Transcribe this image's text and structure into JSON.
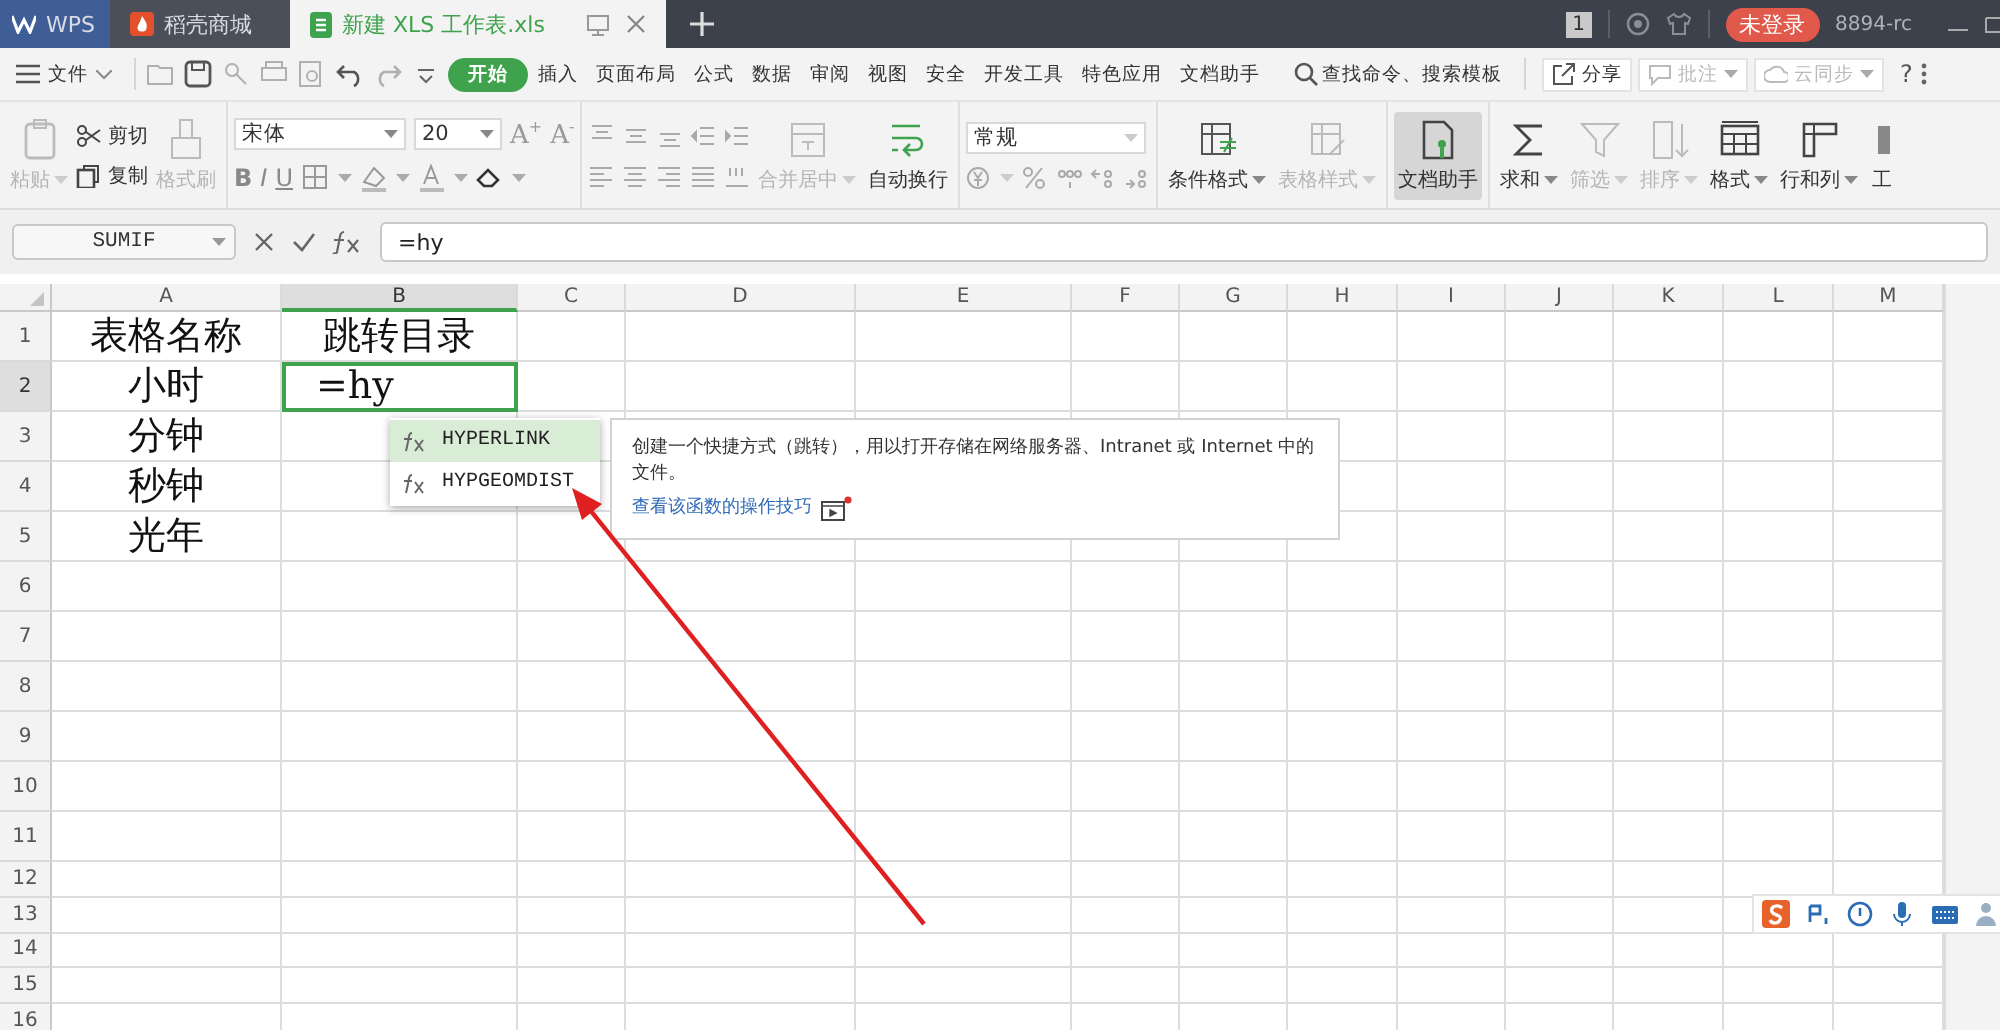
{
  "titlebar": {
    "tabs": [
      {
        "label": "WPS",
        "kind": "home",
        "selected": false
      },
      {
        "label": "稻壳商城",
        "kind": "store",
        "selected": false
      },
      {
        "label": "新建 XLS 工作表.xls",
        "kind": "document",
        "selected": true
      }
    ],
    "badge": "1",
    "login": "未登录",
    "user": "8894-rc"
  },
  "menubar": {
    "file": "文件",
    "tabs": [
      {
        "label": "开始",
        "selected": true
      },
      {
        "label": "插入",
        "selected": false
      },
      {
        "label": "页面布局",
        "selected": false
      },
      {
        "label": "公式",
        "selected": false
      },
      {
        "label": "数据",
        "selected": false
      },
      {
        "label": "审阅",
        "selected": false
      },
      {
        "label": "视图",
        "selected": false
      },
      {
        "label": "安全",
        "selected": false
      },
      {
        "label": "开发工具",
        "selected": false
      },
      {
        "label": "特色应用",
        "selected": false
      },
      {
        "label": "文档助手",
        "selected": false
      }
    ],
    "search": "查找命令、搜索模板",
    "share": "分享",
    "comment": {
      "label": "批注",
      "disabled": true
    },
    "sync": {
      "label": "云同步",
      "disabled": true
    },
    "help": "?"
  },
  "ribbon": {
    "clipboard": [
      {
        "label": "粘贴",
        "disabled": true
      },
      {
        "label": "剪切",
        "disabled": false
      },
      {
        "label": "复制",
        "disabled": false
      },
      {
        "label": "格式刷",
        "disabled": true
      }
    ],
    "font": {
      "name": "宋体",
      "size": "20",
      "grow": "A$^{+}$",
      "shrink": "A$^{-}$",
      "styles": [
        "B",
        "I",
        "U"
      ]
    },
    "merge": {
      "label": "合并居中",
      "disabled": true
    },
    "wrap": {
      "label": "自动换行",
      "disabled": false
    },
    "number_format": "常规",
    "tools": [
      {
        "label": "条件格式",
        "disabled": false,
        "selected": false,
        "dropdown": true
      },
      {
        "label": "表格样式",
        "disabled": true,
        "selected": false,
        "dropdown": true
      },
      {
        "label": "文档助手",
        "disabled": false,
        "selected": true,
        "dropdown": false
      },
      {
        "label": "求和",
        "disabled": false,
        "selected": false,
        "dropdown": true
      },
      {
        "label": "筛选",
        "disabled": true,
        "selected": false,
        "dropdown": true
      },
      {
        "label": "排序",
        "disabled": true,
        "selected": false,
        "dropdown": true
      },
      {
        "label": "格式",
        "disabled": false,
        "selected": false,
        "dropdown": true
      },
      {
        "label": "行和列",
        "disabled": false,
        "selected": false,
        "dropdown": true
      },
      {
        "label": "工",
        "disabled": false,
        "selected": false,
        "dropdown": false
      }
    ]
  },
  "formula_bar": {
    "name_box": "SUMIF",
    "value": "=hy"
  },
  "sheet": {
    "columns": [
      {
        "label": "A",
        "selected": false
      },
      {
        "label": "B",
        "selected": true
      },
      {
        "label": "C",
        "selected": false
      },
      {
        "label": "D",
        "selected": false
      },
      {
        "label": "E",
        "selected": false
      },
      {
        "label": "F",
        "selected": false
      },
      {
        "label": "G",
        "selected": false
      },
      {
        "label": "H",
        "selected": false
      },
      {
        "label": "I",
        "selected": false
      },
      {
        "label": "J",
        "selected": false
      },
      {
        "label": "K",
        "selected": false
      },
      {
        "label": "L",
        "selected": false
      },
      {
        "label": "M",
        "selected": false
      }
    ],
    "rows": [
      {
        "label": "1",
        "selected": false,
        "cells": [
          {
            "text": "表格名称",
            "active": false
          },
          {
            "text": "跳转目录",
            "active": false
          }
        ]
      },
      {
        "label": "2",
        "selected": true,
        "cells": [
          {
            "text": "小时",
            "active": false
          },
          {
            "text": "=hy",
            "active": true
          }
        ]
      },
      {
        "label": "3",
        "selected": false,
        "cells": [
          {
            "text": "分钟",
            "active": false
          }
        ]
      },
      {
        "label": "4",
        "selected": false,
        "cells": [
          {
            "text": "秒钟",
            "active": false
          }
        ]
      },
      {
        "label": "5",
        "selected": false,
        "cells": [
          {
            "text": "光年",
            "active": false
          }
        ]
      },
      {
        "label": "6",
        "selected": false
      },
      {
        "label": "7",
        "selected": false
      },
      {
        "label": "8",
        "selected": false
      },
      {
        "label": "9",
        "selected": false
      },
      {
        "label": "10",
        "selected": false
      },
      {
        "label": "11",
        "selected": false
      },
      {
        "label": "12",
        "selected": false
      },
      {
        "label": "13",
        "selected": false
      },
      {
        "label": "14",
        "selected": false
      },
      {
        "label": "15",
        "selected": false
      },
      {
        "label": "16",
        "selected": false
      }
    ]
  },
  "autocomplete": {
    "items": [
      {
        "label": "HYPERLINK",
        "selected": true
      },
      {
        "label": "HYPGEOMDIST",
        "selected": false
      }
    ],
    "description": "创建一个快捷方式（跳转），用以打开存储在网络服务器、Intranet 或 Internet 中的文件。",
    "link": "查看该函数的操作技巧"
  }
}
